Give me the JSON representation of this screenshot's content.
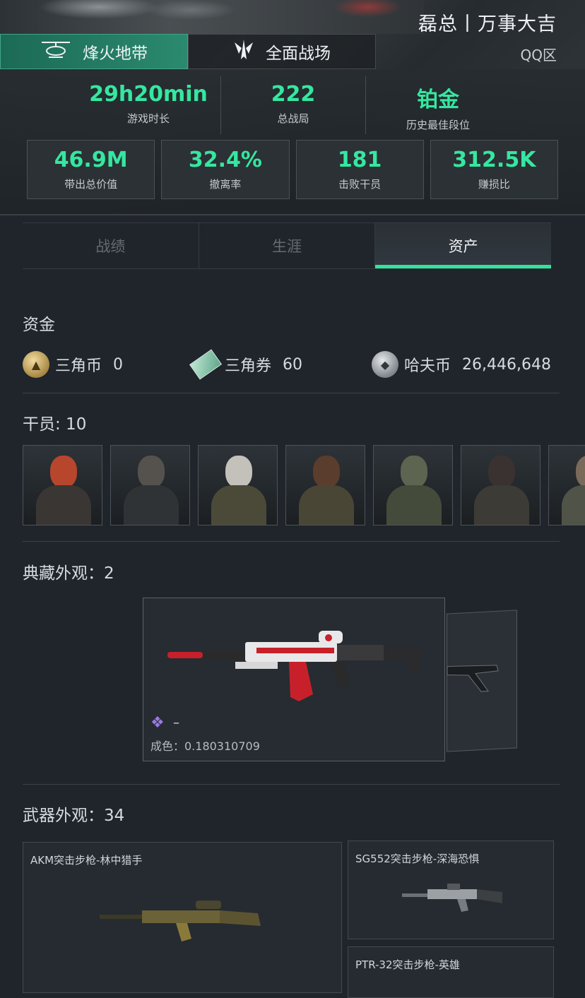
{
  "header": {
    "player_name": "磊总丨万事大吉",
    "region": "QQ区",
    "mode_tabs": [
      {
        "label": "烽火地带",
        "active": true,
        "icon": "helicopter-icon"
      },
      {
        "label": "全面战场",
        "active": false,
        "icon": "wing-emblem-icon"
      }
    ]
  },
  "stats": {
    "play_time": {
      "value": "29h20min",
      "label": "游戏时长"
    },
    "total_matches": {
      "value": "222",
      "label": "总战局"
    },
    "best_rank": {
      "value": "铂金",
      "label": "历史最佳段位"
    },
    "total_value": {
      "value": "46.9M",
      "label": "带出总价值"
    },
    "extract_rate": {
      "value": "32.4%",
      "label": "撤离率"
    },
    "agents_defeated": {
      "value": "181",
      "label": "击败干员"
    },
    "profit_ratio": {
      "value": "312.5K",
      "label": "赚损比"
    }
  },
  "section_tabs": [
    {
      "label": "战绩",
      "active": false
    },
    {
      "label": "生涯",
      "active": false
    },
    {
      "label": "资产",
      "active": true
    }
  ],
  "funds": {
    "title": "资金",
    "currencies": [
      {
        "name": "三角币",
        "value": "0",
        "icon": "triangle-coin-icon"
      },
      {
        "name": "三角券",
        "value": "60",
        "icon": "triangle-ticket-icon"
      },
      {
        "name": "哈夫币",
        "value": "26,446,648",
        "icon": "haf-coin-icon"
      }
    ]
  },
  "agents": {
    "title": "干员: 10"
  },
  "collection": {
    "title": "典藏外观：2",
    "skin_name": "–",
    "wear": "成色：0.180310709",
    "accent": "#c8202a"
  },
  "weapon_skins": {
    "title": "武器外观：34",
    "items": [
      {
        "name": "AKM突击步枪-林中猎手"
      },
      {
        "name": "SG552突击步枪-深海恐惧"
      },
      {
        "name": "PTR-32突击步枪-英雄"
      }
    ]
  },
  "colors": {
    "accent_green": "#35e7a0",
    "background": "#1f252b"
  }
}
